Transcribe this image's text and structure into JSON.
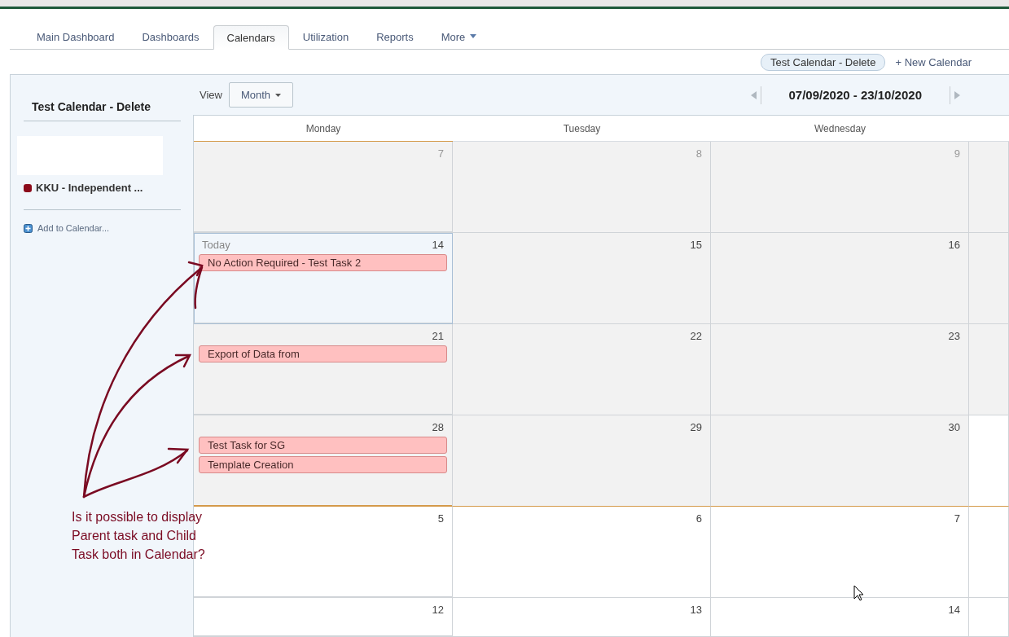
{
  "tabs": [
    {
      "label": "Main Dashboard",
      "selected": false
    },
    {
      "label": "Dashboards",
      "selected": false
    },
    {
      "label": "Calendars",
      "selected": true
    },
    {
      "label": "Utilization",
      "selected": false
    },
    {
      "label": "Reports",
      "selected": false
    },
    {
      "label": "More",
      "selected": false,
      "kind": "dropdown"
    }
  ],
  "calendar_chip": "Test Calendar - Delete",
  "new_calendar": "+ New Calendar",
  "sidebar": {
    "title": "Test Calendar - Delete",
    "calendars": [
      {
        "name": "KKU - Independent ...",
        "color": "#8b0a1a"
      }
    ],
    "add_link": "Add to Calendar..."
  },
  "toolbar": {
    "view_label": "View",
    "view_value": "Month",
    "range": "07/09/2020 - 23/10/2020"
  },
  "weekdays": [
    "Monday",
    "Tuesday",
    "Wednesday"
  ],
  "weeks": [
    {
      "range_end": false,
      "cells": [
        {
          "day": "7",
          "shaded": true
        },
        {
          "day": "8",
          "shaded": true
        },
        {
          "day": "9",
          "shaded": true
        },
        {
          "shaded": true
        }
      ]
    },
    {
      "range_end": false,
      "cells": [
        {
          "day": "14",
          "shaded": false,
          "today": true,
          "today_label": "Today",
          "events": [
            {
              "title": "No Action Required - Test Task 2"
            }
          ]
        },
        {
          "day": "15",
          "shaded": true
        },
        {
          "day": "16",
          "shaded": true
        },
        {
          "shaded": true
        }
      ]
    },
    {
      "range_end": false,
      "cells": [
        {
          "day": "21",
          "shaded": true,
          "events": [
            {
              "title": "Export of Data from"
            }
          ]
        },
        {
          "day": "22",
          "shaded": true
        },
        {
          "day": "23",
          "shaded": true
        },
        {
          "shaded": true
        }
      ]
    },
    {
      "range_end": true,
      "cells": [
        {
          "day": "28",
          "shaded": true,
          "events": [
            {
              "title": "Test Task for SG"
            },
            {
              "title": "Template Creation"
            }
          ]
        },
        {
          "day": "29",
          "shaded": true
        },
        {
          "day": "30",
          "shaded": true
        },
        {
          "shaded": false
        }
      ]
    },
    {
      "range_end": false,
      "cells": [
        {
          "day": "5",
          "shaded": false
        },
        {
          "day": "6",
          "shaded": false
        },
        {
          "day": "7",
          "shaded": false
        },
        {
          "shaded": false
        }
      ]
    },
    {
      "range_end": false,
      "cells": [
        {
          "day": "12",
          "shaded": false
        },
        {
          "day": "13",
          "shaded": false
        },
        {
          "day": "14",
          "shaded": false
        },
        {
          "shaded": false
        }
      ]
    }
  ],
  "annotation": {
    "lines": [
      "Is it possible to display",
      "Parent task and Child",
      "Task both in Calendar?"
    ]
  }
}
